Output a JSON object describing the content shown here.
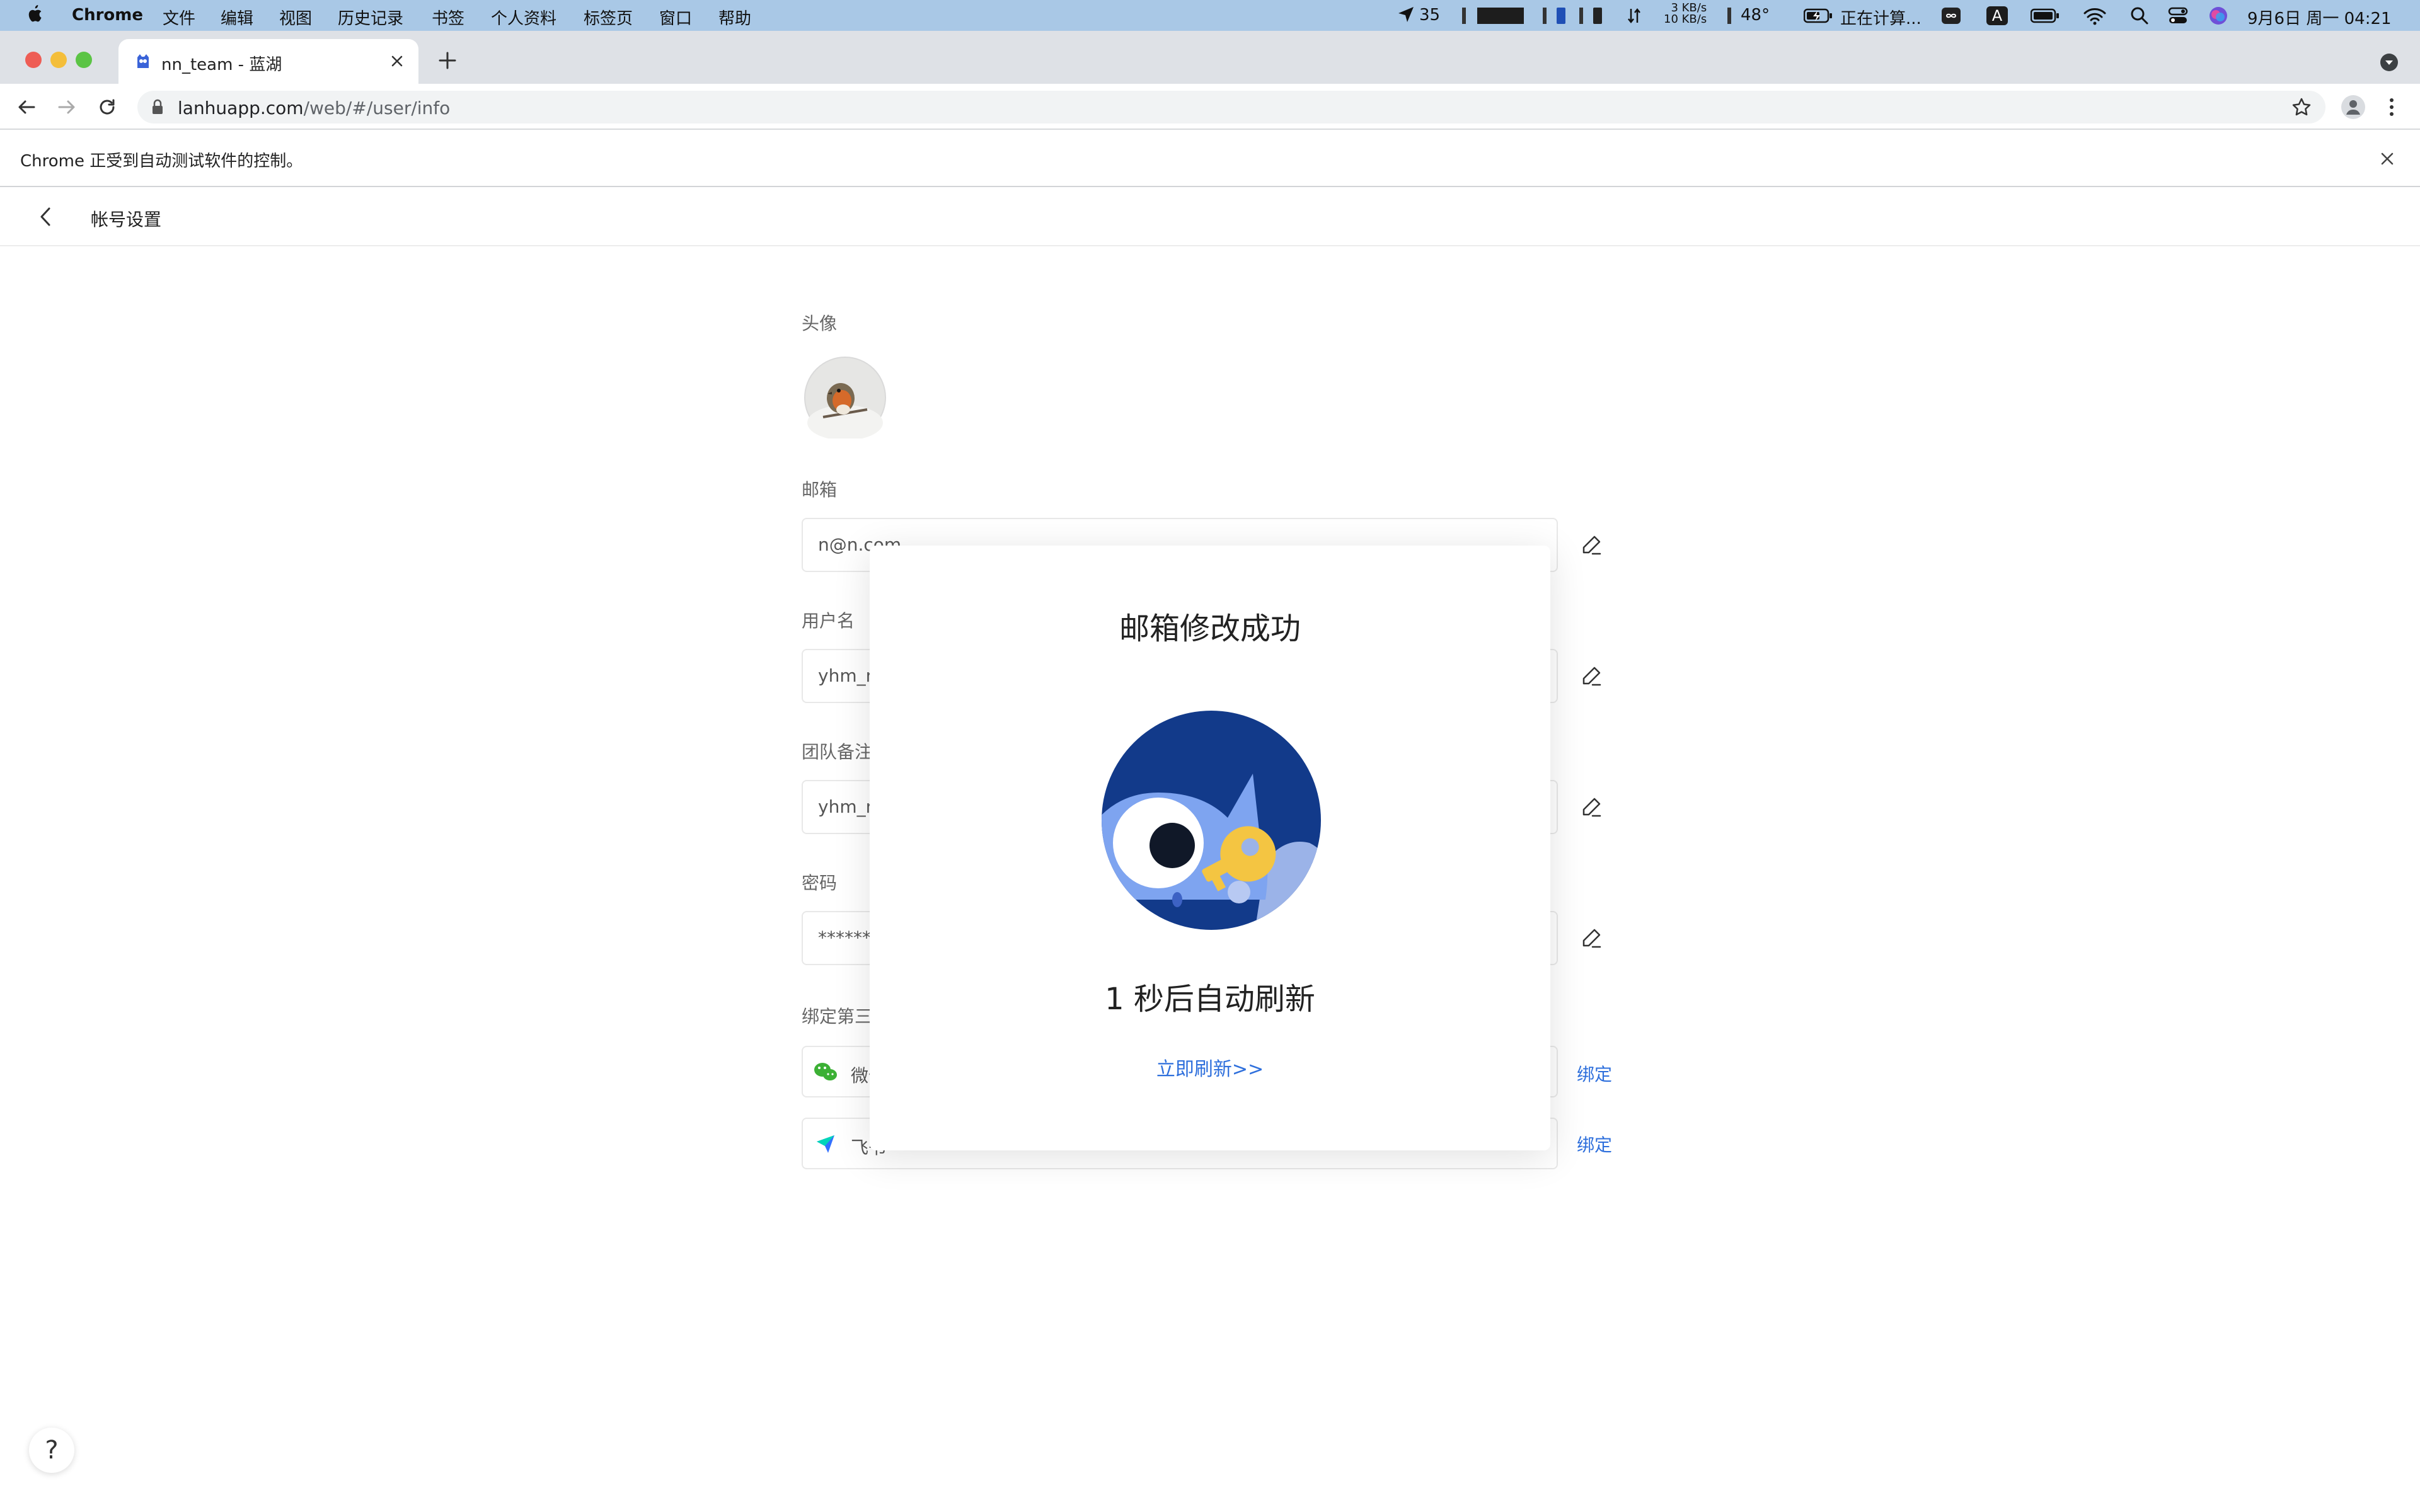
{
  "menubar": {
    "app_name": "Chrome",
    "menus": [
      "文件",
      "编辑",
      "视图",
      "历史记录",
      "书签",
      "个人资料",
      "标签页",
      "窗口",
      "帮助"
    ],
    "status": {
      "location_count": "35",
      "net_up": "3 KB/s",
      "net_down": "10 KB/s",
      "temperature": "48°",
      "computing_text": "正在计算...",
      "input_method": "A",
      "clock": "9月6日 周一  04:21"
    }
  },
  "browser": {
    "tab_title": "nn_team - 蓝湖",
    "url_host": "lanhuapp.com",
    "url_path": "/web/#/user/info",
    "automation_notice": "Chrome 正受到自动测试软件的控制。"
  },
  "page": {
    "title": "帐号设置",
    "avatar_label": "头像",
    "email": {
      "label": "邮箱",
      "value": "n@n.com"
    },
    "username": {
      "label": "用户名",
      "value": "yhm_nn"
    },
    "team_note": {
      "label": "团队备注",
      "value": "yhm_nn"
    },
    "password": {
      "label": "密码",
      "value": "********"
    },
    "third_party": {
      "label": "绑定第三方",
      "accounts": [
        {
          "name": "微信",
          "action": "绑定"
        },
        {
          "name": "飞书",
          "action": "绑定"
        }
      ]
    },
    "help_symbol": "?"
  },
  "modal": {
    "title": "邮箱修改成功",
    "countdown": "1 秒后自动刷新",
    "refresh_link": "立即刷新>>"
  },
  "colors": {
    "menubar": "#a9c8e6",
    "link": "#2e6fdc",
    "illustration_bg": "#123a8a",
    "illustration_owl": "#7ea4f0",
    "illustration_key": "#f4c542"
  }
}
